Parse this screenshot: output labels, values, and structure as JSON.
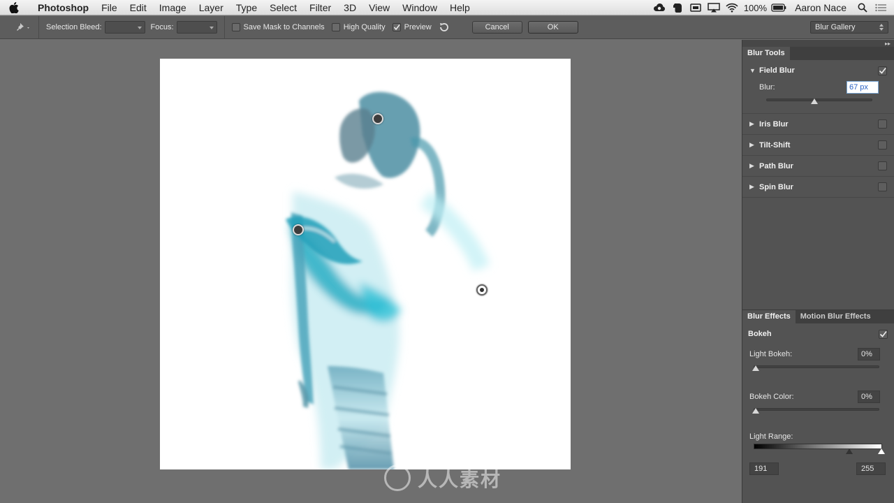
{
  "menubar": {
    "app": "Photoshop",
    "items": [
      "File",
      "Edit",
      "Image",
      "Layer",
      "Type",
      "Select",
      "Filter",
      "3D",
      "View",
      "Window",
      "Help"
    ],
    "battery": "100%",
    "user": "Aaron Nace",
    "icons": [
      "creative-cloud-icon",
      "evernote-icon",
      "screen-icon",
      "airplay-icon",
      "wifi-icon",
      "battery-icon",
      "search-icon",
      "list-icon"
    ]
  },
  "options": {
    "selection_bleed_label": "Selection Bleed:",
    "focus_label": "Focus:",
    "save_mask_label": "Save Mask to Channels",
    "high_quality_label": "High Quality",
    "preview_label": "Preview",
    "cancel_label": "Cancel",
    "ok_label": "OK",
    "workspace": "Blur Gallery"
  },
  "panel": {
    "tools_tab": "Blur Tools",
    "field_blur": {
      "name": "Field Blur",
      "checked": true,
      "blur_label": "Blur:",
      "blur_value": "67 px"
    },
    "blur_list": [
      {
        "name": "Iris Blur",
        "checked": false
      },
      {
        "name": "Tilt-Shift",
        "checked": false
      },
      {
        "name": "Path Blur",
        "checked": false
      },
      {
        "name": "Spin Blur",
        "checked": false
      }
    ],
    "effects_tab": "Blur Effects",
    "motion_tab": "Motion Blur Effects",
    "bokeh_label": "Bokeh",
    "light_bokeh_label": "Light Bokeh:",
    "light_bokeh_value": "0%",
    "bokeh_color_label": "Bokeh Color:",
    "bokeh_color_value": "0%",
    "light_range_label": "Light Range:",
    "light_range_low": "191",
    "light_range_high": "255"
  },
  "watermark": "人人素材",
  "colors": {
    "accent_cyan": "#3fb8c9",
    "panel_bg": "#535353"
  }
}
